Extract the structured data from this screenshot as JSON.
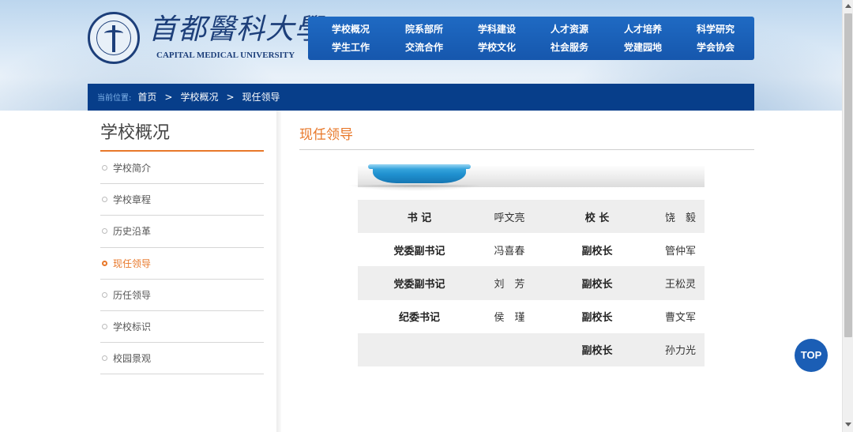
{
  "header": {
    "logo_cn": "首都醫科大學",
    "logo_en": "CAPITAL MEDICAL UNIVERSITY",
    "nav": [
      {
        "label": "学校概况"
      },
      {
        "label": "院系部所"
      },
      {
        "label": "学科建设"
      },
      {
        "label": "人才资源"
      },
      {
        "label": "人才培养"
      },
      {
        "label": "科学研究"
      },
      {
        "label": "学生工作"
      },
      {
        "label": "交流合作"
      },
      {
        "label": "学校文化"
      },
      {
        "label": "社会服务"
      },
      {
        "label": "党建园地"
      },
      {
        "label": "学会协会"
      }
    ]
  },
  "breadcrumb": {
    "prefix": "当前位置:",
    "items": [
      "首页",
      "学校概况",
      "现任领导"
    ],
    "separator": ">"
  },
  "sidebar": {
    "title": "学校概况",
    "items": [
      {
        "label": "学校简介"
      },
      {
        "label": "学校章程"
      },
      {
        "label": "历史沿革"
      },
      {
        "label": "现任领导"
      },
      {
        "label": "历任领导"
      },
      {
        "label": "学校标识"
      },
      {
        "label": "校园景观"
      }
    ],
    "active_index": 3
  },
  "main": {
    "title": "现任领导",
    "leaders": [
      {
        "role1": "书 记",
        "name1": "呼文亮",
        "role2": "校 长",
        "name2": "饶　毅"
      },
      {
        "role1": "党委副书记",
        "name1": "冯喜春",
        "role2": "副校长",
        "name2": "管仲军"
      },
      {
        "role1": "党委副书记",
        "name1": "刘　芳",
        "role2": "副校长",
        "name2": "王松灵"
      },
      {
        "role1": "纪委书记",
        "name1": "侯　瑾",
        "role2": "副校长",
        "name2": "曹文军"
      },
      {
        "role1": "",
        "name1": "",
        "role2": "副校长",
        "name2": "孙力光"
      }
    ]
  },
  "top_button": {
    "label": "TOP"
  },
  "colors": {
    "accent": "#e8782a",
    "nav_blue": "#1657ad",
    "crumb_blue": "#073e8a"
  }
}
